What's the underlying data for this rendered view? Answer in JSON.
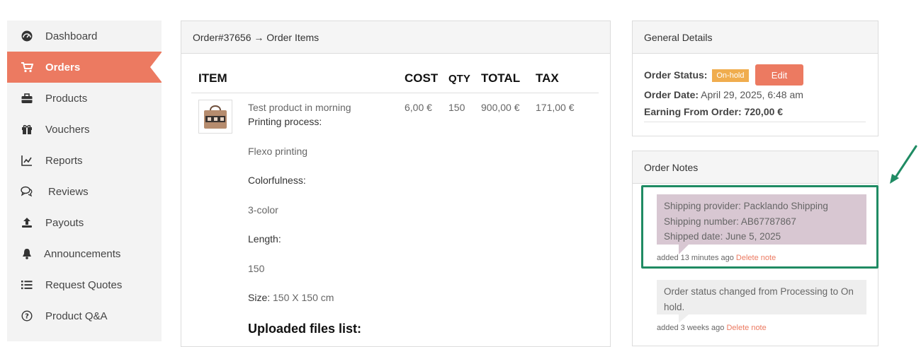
{
  "sidebar": {
    "items": [
      {
        "label": "Dashboard",
        "icon": "dashboard-icon"
      },
      {
        "label": "Orders",
        "icon": "cart-icon",
        "active": true
      },
      {
        "label": "Products",
        "icon": "briefcase-icon"
      },
      {
        "label": "Vouchers",
        "icon": "gift-icon"
      },
      {
        "label": "Reports",
        "icon": "line-chart-icon"
      },
      {
        "label": "Reviews",
        "icon": "comments-icon"
      },
      {
        "label": "Payouts",
        "icon": "upload-icon"
      },
      {
        "label": "Announcements",
        "icon": "bell-icon"
      },
      {
        "label": "Request Quotes",
        "icon": "list-icon"
      },
      {
        "label": "Product Q&A",
        "icon": "question-circle-icon"
      }
    ]
  },
  "order": {
    "header": "Order#37656 → Order Items",
    "columns": {
      "item": "ITEM",
      "cost": "COST",
      "qty": "QTY",
      "total": "TOTAL",
      "tax": "TAX"
    },
    "line": {
      "name": "Test product in morning",
      "cost": "6,00 €",
      "qty": "150",
      "total": "900,00 €",
      "tax": "171,00 €",
      "printing_label": "Printing process:",
      "printing_value": "Flexo printing",
      "colorfulness_label": "Colorfulness:",
      "colorfulness_value": "3-color",
      "length_label": "Length:",
      "length_value": "150",
      "size_label": "Size:",
      "size_value": " 150 X 150 cm",
      "uploaded_heading": "Uploaded files list:"
    }
  },
  "general": {
    "header": "General Details",
    "status_label": "Order Status:",
    "status_badge": "On-hold",
    "edit_label": "Edit",
    "date_label": "Order Date:",
    "date_value": " April 29, 2025, 6:48 am",
    "earning_label": "Earning From Order:",
    "earning_value": " 720,00 €"
  },
  "notes": {
    "header": "Order Notes",
    "items": [
      {
        "lines": [
          "Shipping provider: Packlando Shipping",
          "Shipping number: AB67787867",
          "Shipped date: June 5, 2025"
        ],
        "meta": "added 13 minutes ago ",
        "delete": "Delete note"
      },
      {
        "lines": [
          "Order status changed from Processing to On",
          "hold."
        ],
        "meta": "added 3 weeks ago ",
        "delete": "Delete note"
      }
    ]
  },
  "colors": {
    "accent": "#ec7a61",
    "badge": "#f0ad4e",
    "highlight": "#1f8b63",
    "note_shipping": "#d8c7d2",
    "note_system": "#eeeeee"
  }
}
